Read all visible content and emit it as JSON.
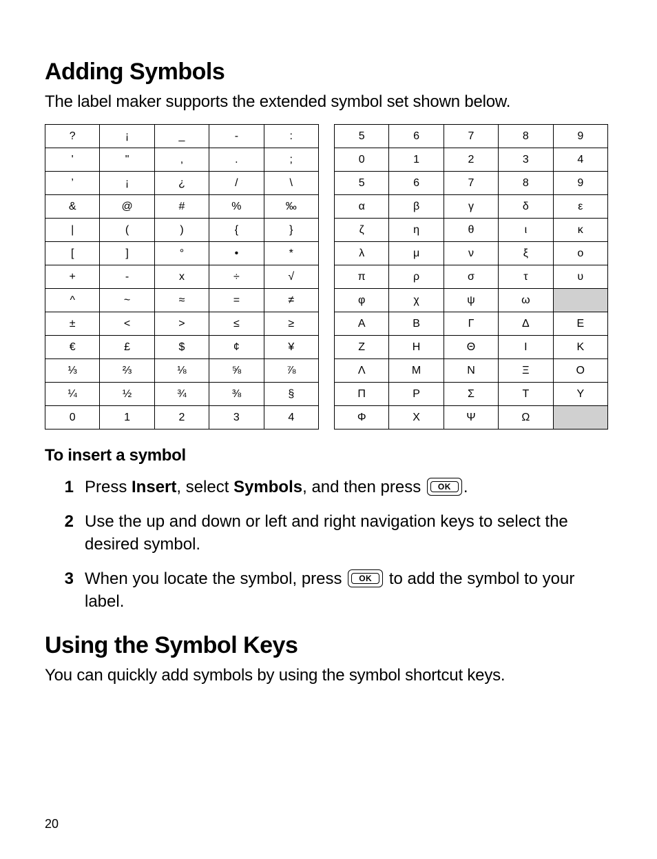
{
  "section1": {
    "heading": "Adding Symbols",
    "intro": "The label maker supports the extended symbol set shown below.",
    "subhead": "To insert a symbol"
  },
  "tables": {
    "left": [
      [
        "?",
        "¡",
        "_",
        "-",
        ":"
      ],
      [
        "'",
        "\"",
        ",",
        ".",
        ";"
      ],
      [
        "’",
        "¡",
        "¿",
        "/",
        "\\"
      ],
      [
        "&",
        "@",
        "#",
        "%",
        "‰"
      ],
      [
        "|",
        "(",
        ")",
        "{",
        "}"
      ],
      [
        "[",
        "]",
        "°",
        "•",
        "*"
      ],
      [
        "+",
        "-",
        "x",
        "÷",
        "√"
      ],
      [
        "^",
        "~",
        "≈",
        "=",
        "≠"
      ],
      [
        "±",
        "<",
        ">",
        "≤",
        "≥"
      ],
      [
        "€",
        "£",
        "$",
        "¢",
        "¥"
      ],
      [
        "⅓",
        "⅔",
        "⅛",
        "⅝",
        "⅞"
      ],
      [
        "¼",
        "½",
        "¾",
        "⅜",
        "§"
      ],
      [
        "0",
        "1",
        "2",
        "3",
        "4"
      ]
    ],
    "right": [
      [
        "5",
        "6",
        "7",
        "8",
        "9"
      ],
      [
        "0",
        "1",
        "2",
        "3",
        "4"
      ],
      [
        "5",
        "6",
        "7",
        "8",
        "9"
      ],
      [
        "α",
        "β",
        "γ",
        "δ",
        "ε"
      ],
      [
        "ζ",
        "η",
        "θ",
        "ι",
        "κ"
      ],
      [
        "λ",
        "μ",
        "ν",
        "ξ",
        "ο"
      ],
      [
        "π",
        "ρ",
        "σ",
        "τ",
        "υ"
      ],
      [
        "φ",
        "χ",
        "ψ",
        "ω",
        ""
      ],
      [
        "Α",
        "Β",
        "Γ",
        "Δ",
        "Ε"
      ],
      [
        "Ζ",
        "Η",
        "Θ",
        "Ι",
        "Κ"
      ],
      [
        "Λ",
        "Μ",
        "Ν",
        "Ξ",
        "Ο"
      ],
      [
        "Π",
        "Ρ",
        "Σ",
        "Τ",
        "Υ"
      ],
      [
        "Φ",
        "Χ",
        "Ψ",
        "Ω",
        ""
      ]
    ]
  },
  "steps": {
    "s1a": "Press ",
    "s1b": "Insert",
    "s1c": ", select ",
    "s1d": "Symbols",
    "s1e": ", and then press ",
    "s1f": ".",
    "s2": "Use the up and down or left and right navigation keys to select the desired symbol.",
    "s3a": "When you locate the symbol, press ",
    "s3b": " to add the symbol to your label."
  },
  "ok_label": "OK",
  "section2": {
    "heading": "Using the Symbol Keys",
    "intro": "You can quickly add symbols by using the symbol shortcut keys."
  },
  "page_number": "20"
}
